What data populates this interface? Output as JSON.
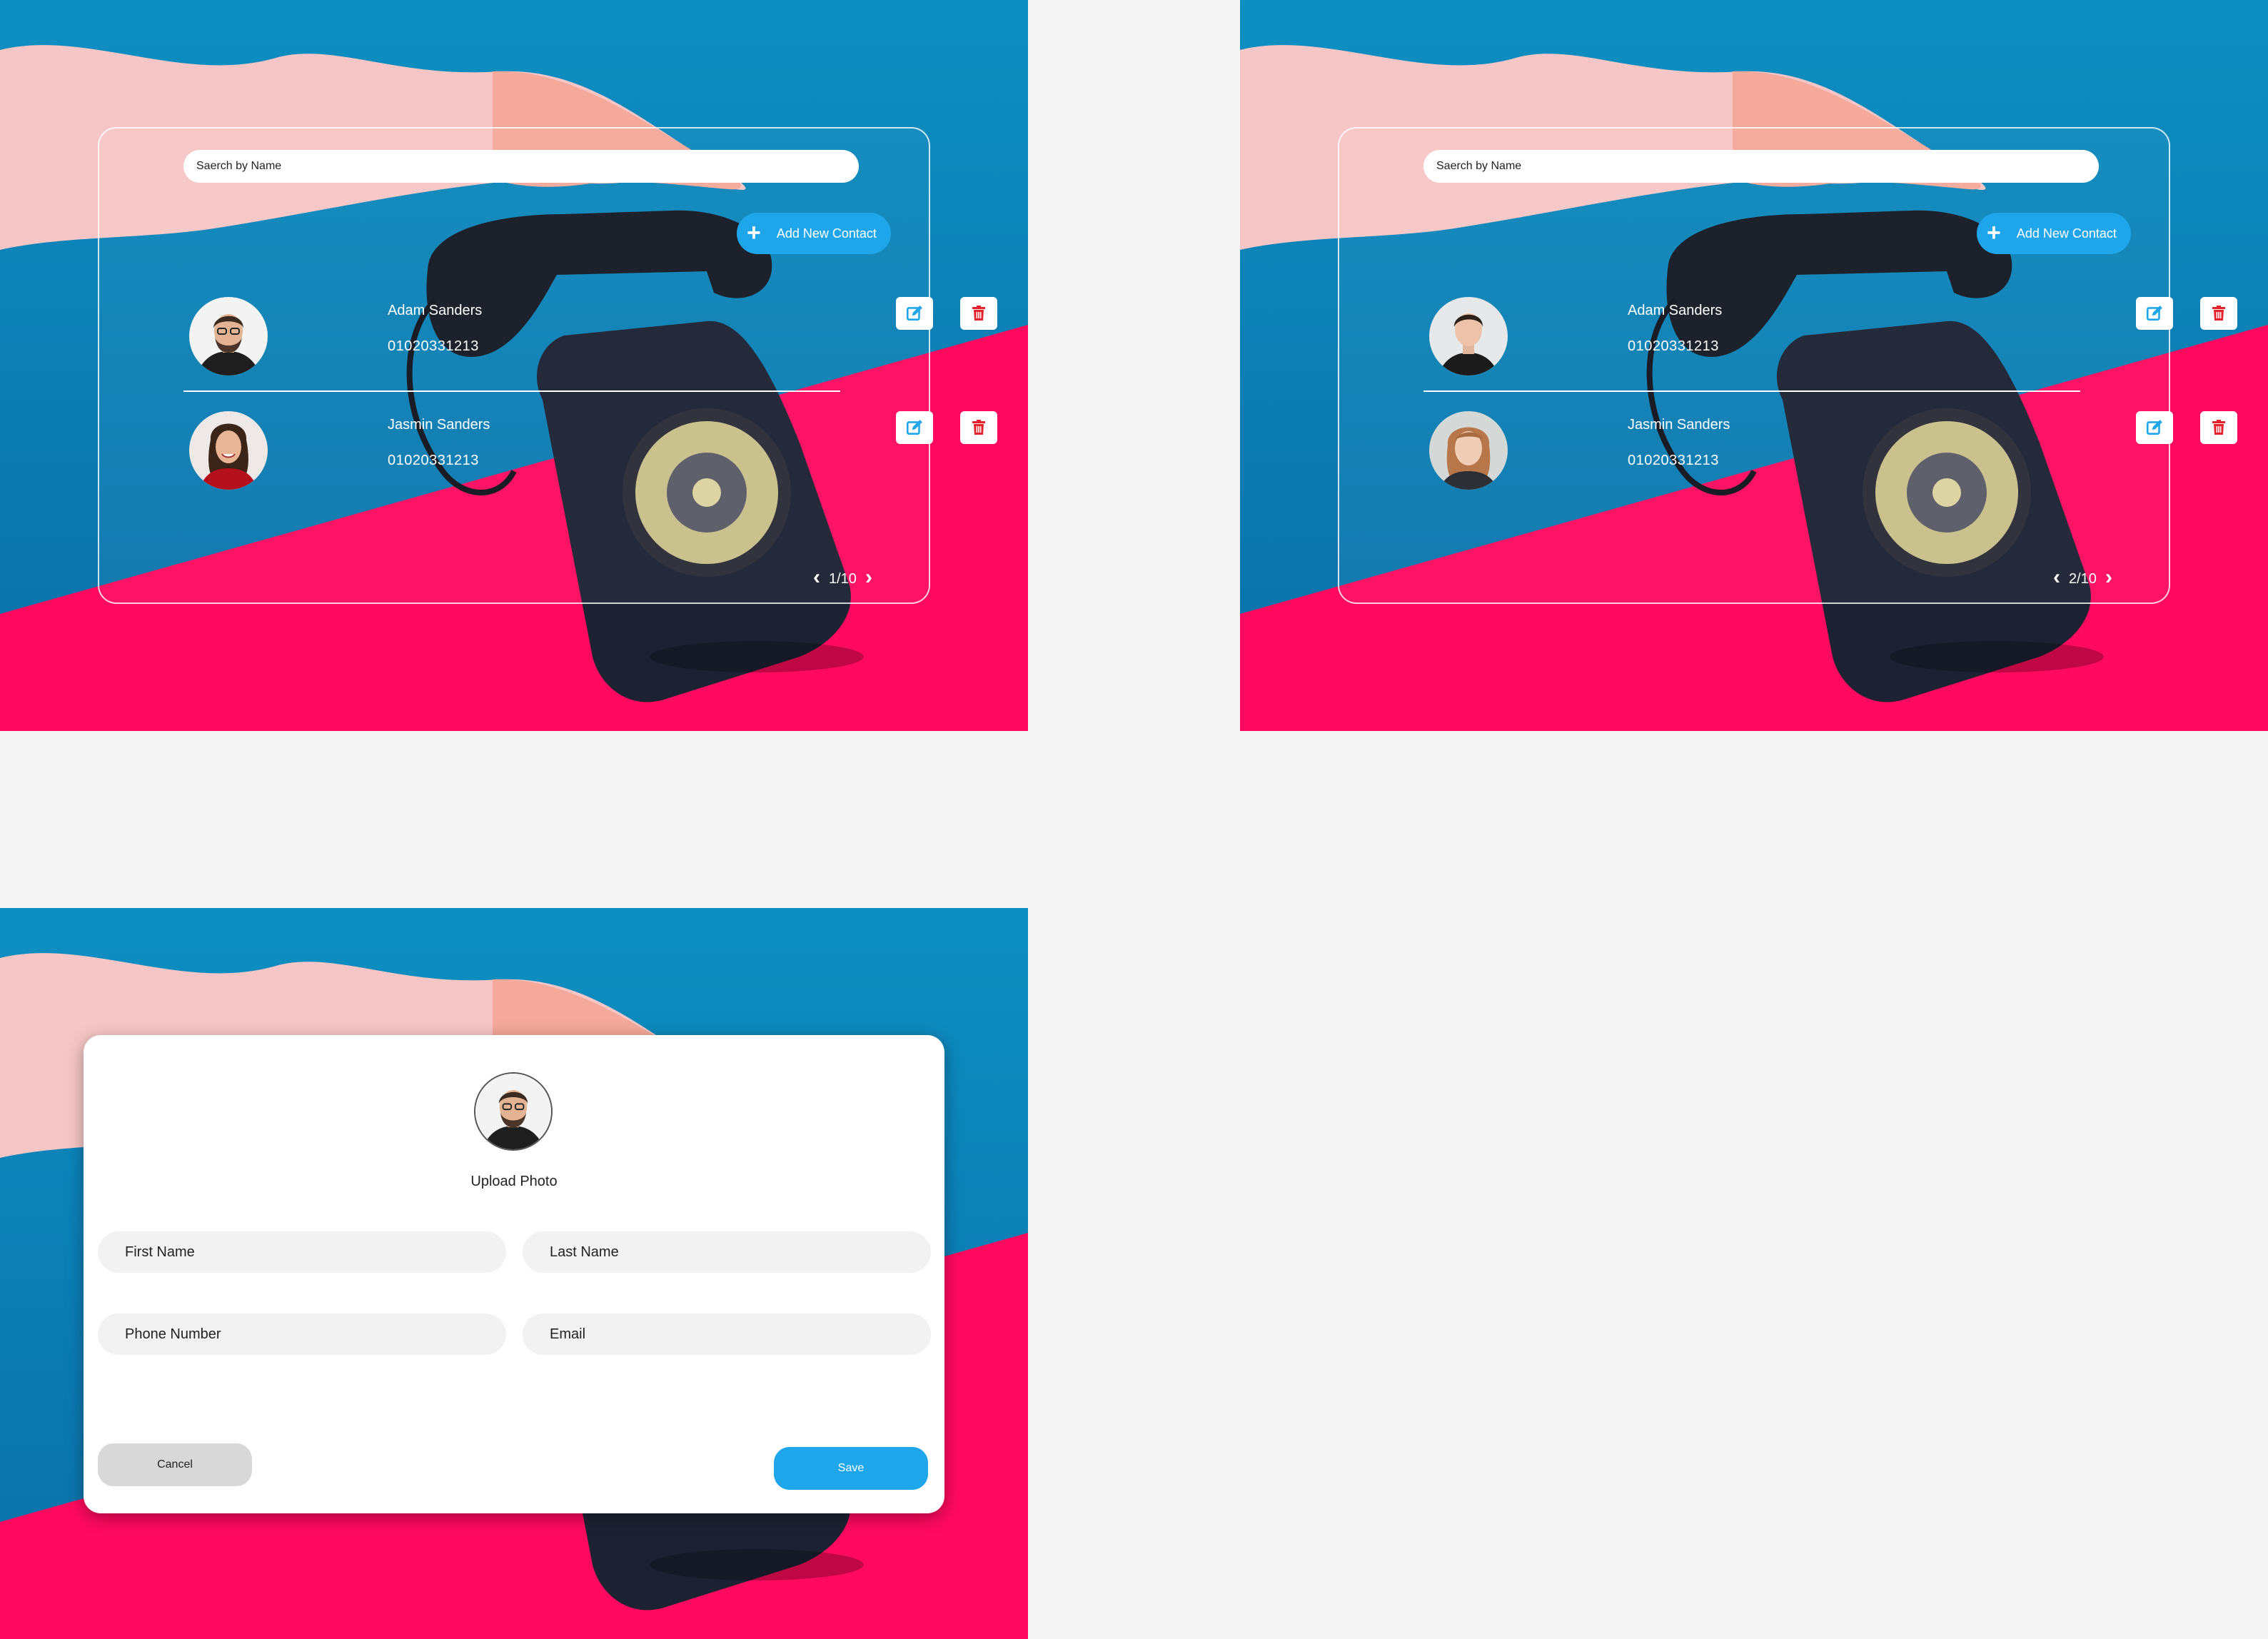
{
  "screens": [
    {
      "search_placeholder": "Saerch by Name",
      "add_button_label": "Add New Contact",
      "contacts": [
        {
          "name": "Adam Sanders",
          "phone": "01020331213"
        },
        {
          "name": "Jasmin Sanders",
          "phone": "01020331213"
        }
      ],
      "pagination": "1/10"
    },
    {
      "search_placeholder": "Saerch by Name",
      "add_button_label": "Add New Contact",
      "contacts": [
        {
          "name": "Adam Sanders",
          "phone": "01020331213"
        },
        {
          "name": "Jasmin Sanders",
          "phone": "01020331213"
        }
      ],
      "pagination": "2/10"
    }
  ],
  "form": {
    "upload_label": "Upload Photo",
    "first_name_placeholder": "First Name",
    "last_name_placeholder": "Last Name",
    "phone_placeholder": "Phone Number",
    "email_placeholder": "Email",
    "cancel_label": "Cancel",
    "save_label": "Save"
  },
  "colors": {
    "accent": "#1fa6ea",
    "background_blue": "#0f8fc0",
    "background_pink": "#ff0a5e",
    "delete": "#e3232c"
  },
  "icons": {
    "add": "plus-icon",
    "edit": "edit-icon",
    "delete": "trash-icon",
    "prev": "chevron-left-icon",
    "next": "chevron-right-icon"
  }
}
